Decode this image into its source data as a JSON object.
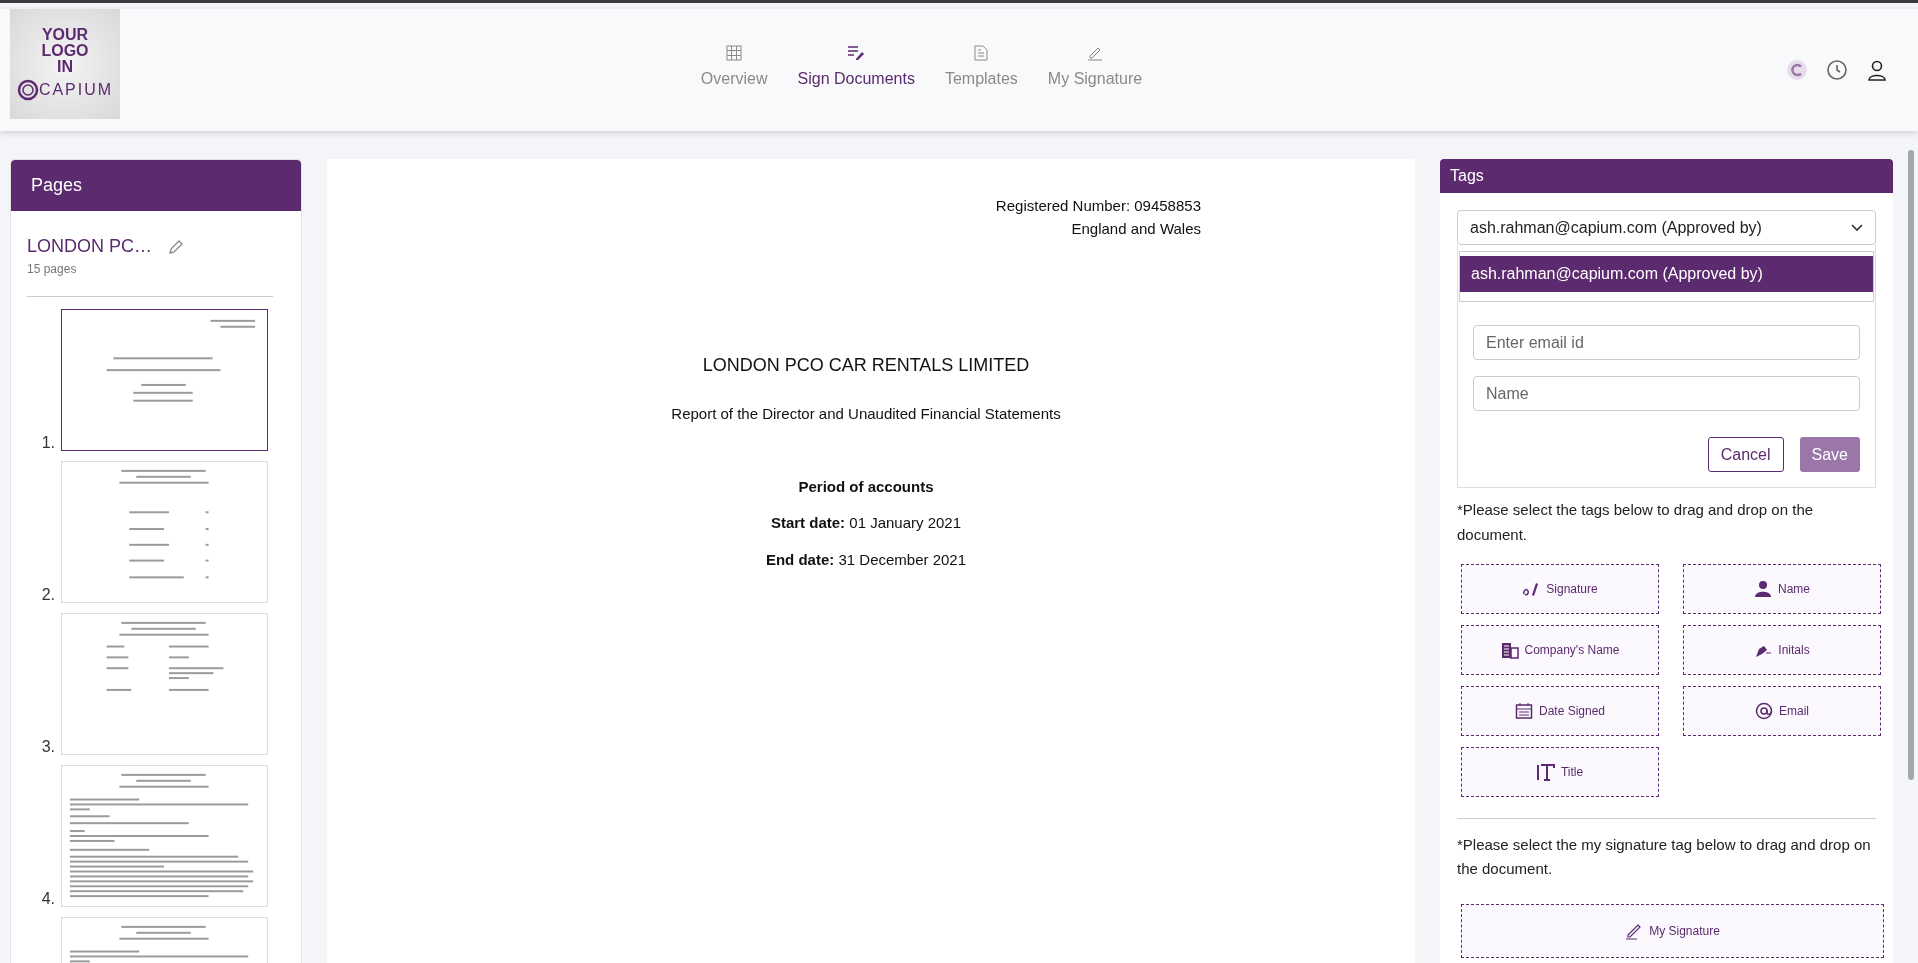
{
  "logo": {
    "lines": [
      "YOUR",
      "LOGO",
      "IN",
      "CAPIUM"
    ]
  },
  "nav": [
    {
      "label": "Overview",
      "selected": false
    },
    {
      "label": "Sign Documents",
      "selected": true
    },
    {
      "label": "Templates",
      "selected": false
    },
    {
      "label": "My Signature",
      "selected": false
    }
  ],
  "pages_panel": {
    "title": "Pages",
    "document_name": "LONDON PC…",
    "page_count": "15 pages",
    "pages": [
      {
        "number": "1.",
        "selected": true,
        "kind": "cover"
      },
      {
        "number": "2.",
        "selected": false,
        "kind": "contents"
      },
      {
        "number": "3.",
        "selected": false,
        "kind": "info"
      },
      {
        "number": "4.",
        "selected": false,
        "kind": "report"
      },
      {
        "selected": false,
        "kind": "report"
      }
    ]
  },
  "document": {
    "registered": "Registered Number: 09458853",
    "jurisdiction": "England and Wales",
    "company": "LONDON PCO CAR RENTALS LIMITED",
    "report": "Report of the Director and Unaudited Financial Statements",
    "period_heading": "Period of accounts",
    "dates": [
      "**Start date:** 01 January 2021",
      "**End date:** 31 December 2021"
    ]
  },
  "tags_panel": {
    "title": "Tags",
    "signer_select": {
      "value": "ash.rahman@capium.com (Approved by)"
    },
    "dropdown_options": [
      {
        "label": "ash.rahman@capium.com (Approved by)",
        "selected": true
      }
    ],
    "email_field": {
      "placeholder": "Enter email id"
    },
    "name_field": {
      "placeholder": "Name"
    },
    "buttons": [
      {
        "label": "Cancel",
        "kind": "outline",
        "disabled": false
      },
      {
        "label": "Save",
        "kind": "filled",
        "disabled": true
      }
    ],
    "tags_hint": "*Please select the tags below to drag and drop on the document.",
    "tags": [
      {
        "label": "Signature"
      },
      {
        "label": "Name"
      },
      {
        "label": "Company's Name"
      },
      {
        "label": "Initals"
      },
      {
        "label": "Date Signed"
      },
      {
        "label": "Email"
      },
      {
        "label": "Title"
      }
    ],
    "my_signature_hint": "*Please select the my signature tag below to drag and drop on the document.",
    "my_signature_tag": {
      "label": "My Signature"
    }
  }
}
